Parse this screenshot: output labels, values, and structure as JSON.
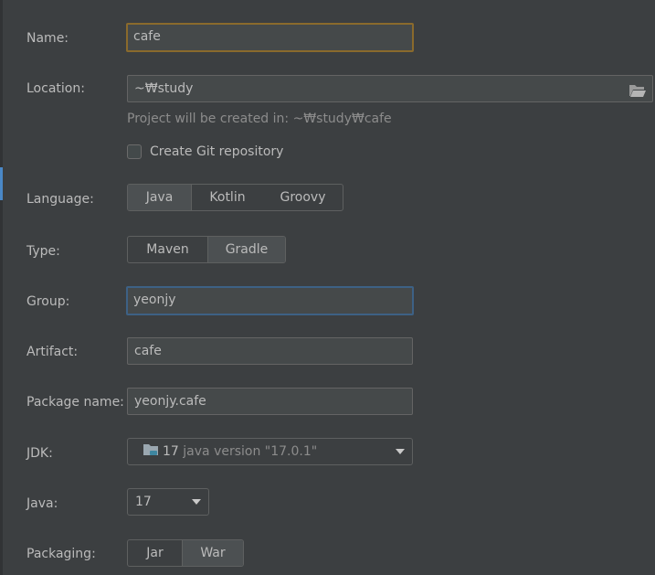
{
  "form": {
    "name": {
      "label": "Name:",
      "value": "cafe"
    },
    "location": {
      "label": "Location:",
      "value": "~₩study",
      "folder_icon": "folder-open-icon"
    },
    "location_hint": "Project will be created in: ~₩study₩cafe",
    "git": {
      "label": "Create Git repository",
      "checked": false
    },
    "language": {
      "label": "Language:",
      "options": [
        "Java",
        "Kotlin",
        "Groovy"
      ],
      "selected": "Java"
    },
    "type": {
      "label": "Type:",
      "options": [
        "Maven",
        "Gradle"
      ],
      "selected": "Gradle"
    },
    "group": {
      "label": "Group:",
      "value": "yeonjy"
    },
    "artifact": {
      "label": "Artifact:",
      "value": "cafe"
    },
    "package_name": {
      "label": "Package name:",
      "value": "yeonjy.cafe"
    },
    "jdk": {
      "label": "JDK:",
      "version": "17",
      "detail": "java version \"17.0.1\"",
      "icon": "jdk-folder-icon"
    },
    "java": {
      "label": "Java:",
      "value": "17"
    },
    "packaging": {
      "label": "Packaging:",
      "options": [
        "Jar",
        "War"
      ],
      "selected": "War"
    }
  },
  "colors": {
    "background": "#3c3f41",
    "field_bg": "#45494a",
    "focus_orange": "#8a6a2c",
    "focus_blue": "#3d6185",
    "accent": "#4a88c7",
    "hint_text": "#8c8c8c"
  }
}
